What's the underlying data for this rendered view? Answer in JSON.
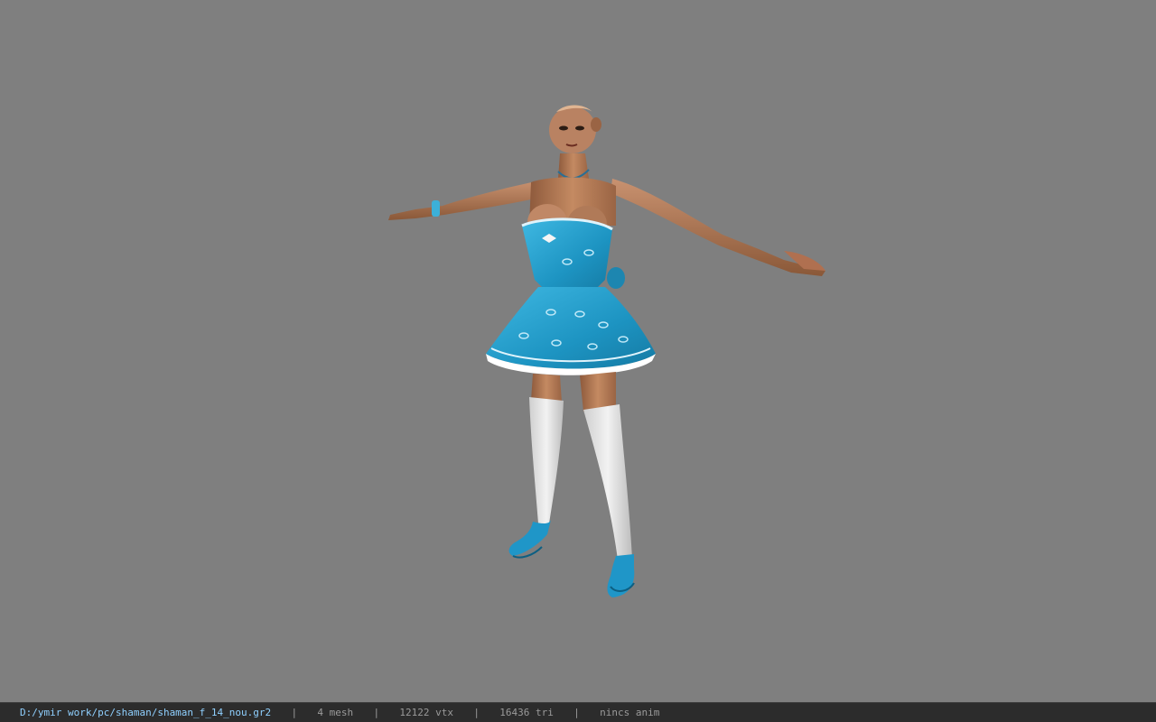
{
  "viewer": {
    "background_color": "#7f7f7f",
    "model_name": "3d-character-model"
  },
  "statusbar": {
    "file_path": "D:/ymir work/pc/shaman/shaman_f_14_nou.gr2",
    "separator": "|",
    "mesh_count": "4 mesh",
    "vertex_count": "12122 vtx",
    "triangle_count": "16436 tri",
    "animation": "nincs anim",
    "path_color": "#8fd0ff",
    "text_color": "#9a9a9a"
  },
  "model_colors": {
    "dress": "#2a9ec8",
    "dress_light": "#5cc4e6",
    "skin": "#b87c56",
    "stockings": "#e6e6e6",
    "shoes": "#2a9ec8"
  }
}
